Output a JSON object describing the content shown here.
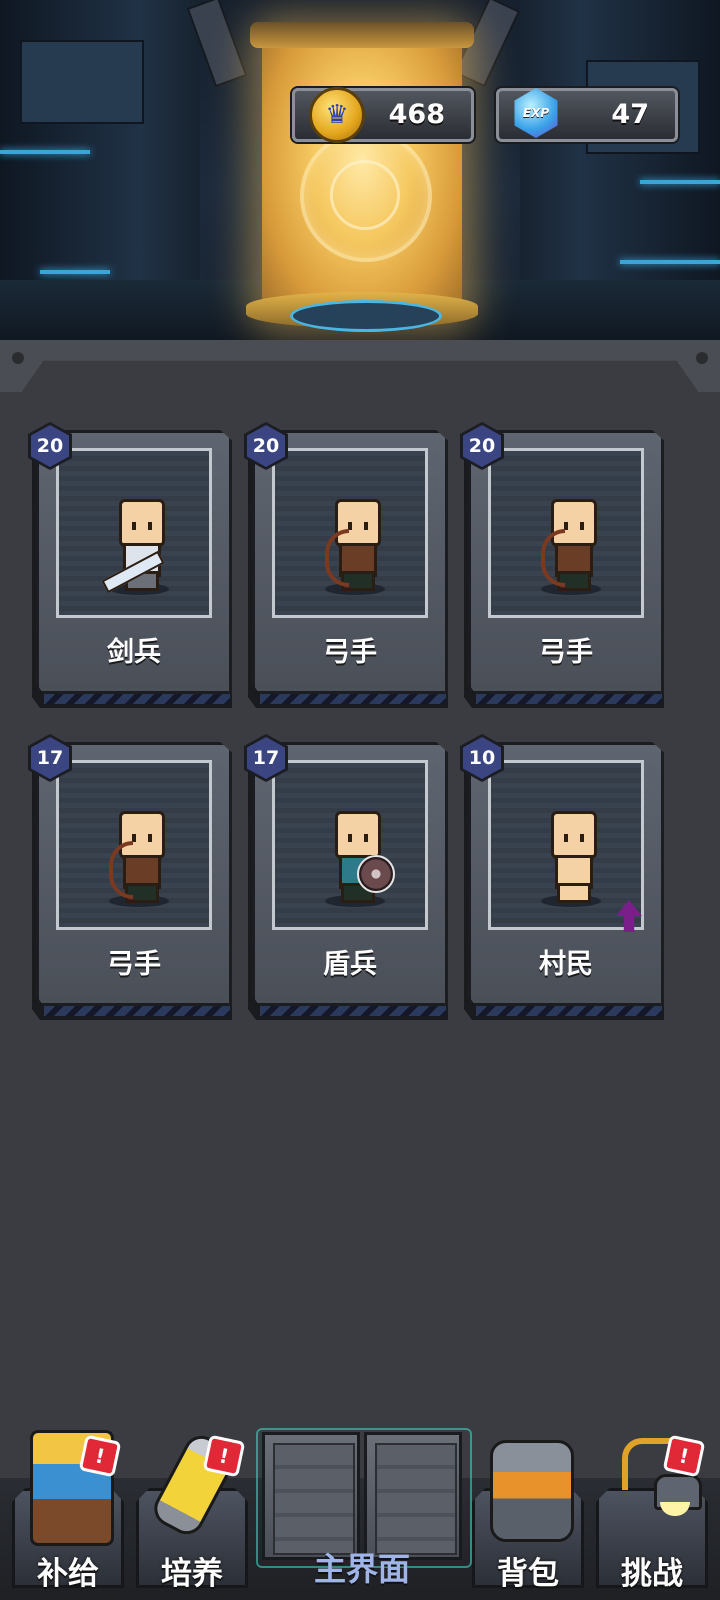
{
  "currency": {
    "gold": {
      "icon": "crown-coin-icon",
      "value": "468"
    },
    "exp": {
      "icon": "exp-gem-icon",
      "badge": "EXP",
      "value": "47"
    }
  },
  "units": [
    {
      "level": "20",
      "name": "剑兵",
      "icon": "swordsman-sprite"
    },
    {
      "level": "20",
      "name": "弓手",
      "icon": "archer-sprite"
    },
    {
      "level": "20",
      "name": "弓手",
      "icon": "archer-sprite"
    },
    {
      "level": "17",
      "name": "弓手",
      "icon": "archer-sprite"
    },
    {
      "level": "17",
      "name": "盾兵",
      "icon": "shield-soldier-sprite"
    },
    {
      "level": "10",
      "name": "村民",
      "icon": "villager-sprite",
      "upgrade_available": true
    }
  ],
  "nav": {
    "supply": {
      "label": "补给",
      "alert": "!"
    },
    "train": {
      "label": "培养",
      "alert": "!"
    },
    "main": {
      "label": "主界面"
    },
    "bag": {
      "label": "背包"
    },
    "challenge": {
      "label": "挑战",
      "alert": "!"
    }
  },
  "colors": {
    "accent_glow": "#f5c860",
    "badge": "#3a4582",
    "alert": "#e02836",
    "main_label": "#9fb4e8"
  }
}
